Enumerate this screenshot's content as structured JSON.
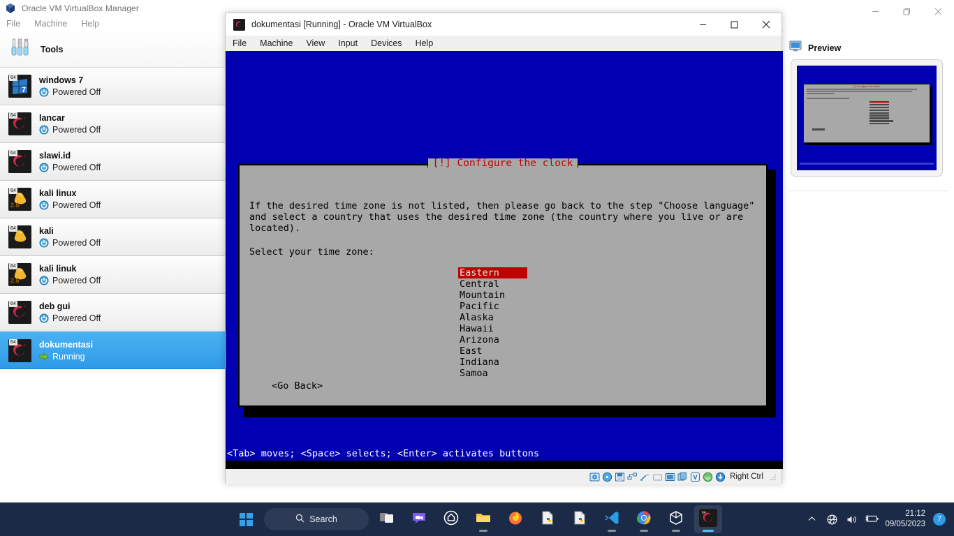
{
  "manager_window": {
    "title": "Oracle VM VirtualBox Manager",
    "title_icon": "virtualbox-cube-icon",
    "menus": [
      "File",
      "Machine",
      "Help"
    ],
    "window_controls": [
      {
        "name": "minimize-button",
        "glyph": "—"
      },
      {
        "name": "restore-button",
        "glyph": "❐"
      },
      {
        "name": "close-button",
        "glyph": "✕"
      }
    ],
    "tools_item": {
      "label": "Tools",
      "icon": "tools-icon"
    },
    "machines": [
      {
        "name": "windows 7",
        "state": "Powered Off",
        "os_badge": "64",
        "icon": "windows7-icon",
        "state_icon": "power-off-icon",
        "selected": false
      },
      {
        "name": "lancar",
        "state": "Powered Off",
        "os_badge": "64",
        "icon": "debian-swirl-icon",
        "state_icon": "power-off-icon",
        "selected": false
      },
      {
        "name": "slawi.id",
        "state": "Powered Off",
        "os_badge": "64",
        "icon": "debian-swirl-icon",
        "state_icon": "power-off-icon",
        "selected": false
      },
      {
        "name": "kali linux",
        "state": "Powered Off",
        "os_badge": "64",
        "version_badge": "2.6",
        "icon": "linux-tux-icon",
        "state_icon": "power-off-icon",
        "selected": false
      },
      {
        "name": "kali",
        "state": "Powered Off",
        "os_badge": "64",
        "icon": "linux-tux-icon",
        "state_icon": "power-off-icon",
        "selected": false
      },
      {
        "name": "kali linuk",
        "state": "Powered Off",
        "os_badge": "64",
        "version_badge": "2.6",
        "icon": "linux-tux-icon",
        "state_icon": "power-off-icon",
        "selected": false
      },
      {
        "name": "deb gui",
        "state": "Powered Off",
        "os_badge": "64",
        "icon": "debian-swirl-icon",
        "state_icon": "power-off-icon",
        "selected": false
      },
      {
        "name": "dokumentasi",
        "state": "Running",
        "os_badge": "64",
        "icon": "debian-swirl-icon",
        "state_icon": "running-arrow-icon",
        "selected": true
      }
    ],
    "details": {
      "preview_label": "Preview",
      "preview_icon": "monitor-icon"
    }
  },
  "vm_window": {
    "title": "dokumentasi [Running] - Oracle VM VirtualBox",
    "title_icon": "debian-vm-icon",
    "menus": [
      "File",
      "Machine",
      "View",
      "Input",
      "Devices",
      "Help"
    ],
    "window_controls": [
      {
        "name": "minimize-button",
        "glyph": "—"
      },
      {
        "name": "maximize-button",
        "glyph": "☐"
      },
      {
        "name": "close-button",
        "glyph": "✕"
      }
    ],
    "statusbar": {
      "icons": [
        "harddisk-icon",
        "optical-disk-icon",
        "floppy-icon",
        "network-icon",
        "usb-icon",
        "shared-folder-icon",
        "display-icon",
        "video-capture-icon",
        "virtualization-icon",
        "mouse-integration-icon",
        "keyboard-icon"
      ],
      "host_key": "Right Ctrl",
      "grip": "resize-grip"
    },
    "screen": {
      "colors": {
        "background": "#0000b0",
        "dialog": "#a8a8a8",
        "title": "#c00000",
        "highlight": "#c00000"
      },
      "dialog": {
        "title": "[!] Configure the clock",
        "body": "If the desired time zone is not listed, then please go back to the step \"Choose language\"\nand select a country that uses the desired time zone (the country where you live or are\nlocated).",
        "prompt": "Select your time zone:",
        "timezones": [
          {
            "label": "Eastern",
            "selected": true
          },
          {
            "label": "Central",
            "selected": false
          },
          {
            "label": "Mountain",
            "selected": false
          },
          {
            "label": "Pacific",
            "selected": false
          },
          {
            "label": "Alaska",
            "selected": false
          },
          {
            "label": "Hawaii",
            "selected": false
          },
          {
            "label": "Arizona",
            "selected": false
          },
          {
            "label": "East Indiana",
            "selected": false
          },
          {
            "label": "Samoa",
            "selected": false
          }
        ],
        "go_back_button": "<Go Back>"
      },
      "help_bar": "<Tab> moves; <Space> selects; <Enter> activates buttons"
    }
  },
  "taskbar": {
    "start_icon": "windows-start-icon",
    "search": {
      "placeholder": "Search",
      "icon": "search-icon"
    },
    "items": [
      {
        "name": "task-view",
        "icon": "task-view-icon",
        "running": false
      },
      {
        "name": "teams-chat",
        "icon": "teams-chat-icon",
        "running": false
      },
      {
        "name": "brave-browser",
        "icon": "brave-browser-icon",
        "running": false
      },
      {
        "name": "file-explorer",
        "icon": "file-explorer-icon",
        "running": true
      },
      {
        "name": "firefox",
        "icon": "firefox-icon",
        "running": false
      },
      {
        "name": "python-idle-1",
        "icon": "python-file-icon",
        "running": false
      },
      {
        "name": "python-idle-2",
        "icon": "python-file-icon",
        "running": false
      },
      {
        "name": "vs-code",
        "icon": "vscode-icon",
        "running": true
      },
      {
        "name": "google-chrome",
        "icon": "chrome-icon",
        "running": true
      },
      {
        "name": "virtualbox",
        "icon": "virtualbox-cube-icon",
        "running": true
      },
      {
        "name": "virtualbox-vm",
        "icon": "debian-vm-icon",
        "running": true,
        "active": true
      }
    ],
    "tray": {
      "chevron": "chevron-up-icon",
      "network": "network-no-internet-icon",
      "volume": "volume-icon",
      "battery": "battery-charging-icon",
      "time": "21:12",
      "date": "09/05/2023",
      "notification_count": "7"
    }
  }
}
